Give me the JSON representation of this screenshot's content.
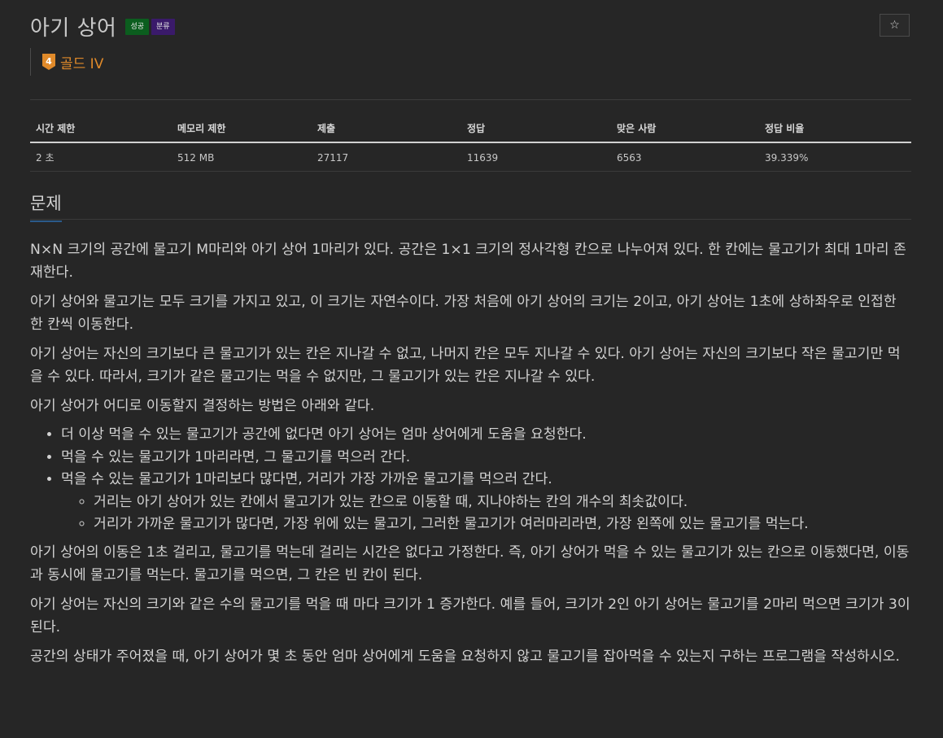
{
  "problem": {
    "title": "아기 상어",
    "badges": {
      "success": "성공",
      "tags": "분류"
    },
    "star_icon": "☆",
    "tier": {
      "number": "4",
      "label": "골드 IV",
      "color": "#e08a2a"
    }
  },
  "info_table": {
    "headers": [
      "시간 제한",
      "메모리 제한",
      "제출",
      "정답",
      "맞은 사람",
      "정답 비율"
    ],
    "values": [
      "2 초",
      "512 MB",
      "27117",
      "11639",
      "6563",
      "39.339%"
    ]
  },
  "section": {
    "title": "문제"
  },
  "description": {
    "p1": "N×N 크기의 공간에 물고기 M마리와 아기 상어 1마리가 있다. 공간은 1×1 크기의 정사각형 칸으로 나누어져 있다. 한 칸에는 물고기가 최대 1마리 존재한다.",
    "p2": "아기 상어와 물고기는 모두 크기를 가지고 있고, 이 크기는 자연수이다. 가장 처음에 아기 상어의 크기는 2이고, 아기 상어는 1초에 상하좌우로 인접한 한 칸씩 이동한다.",
    "p3": "아기 상어는 자신의 크기보다 큰 물고기가 있는 칸은 지나갈 수 없고, 나머지 칸은 모두 지나갈 수 있다. 아기 상어는 자신의 크기보다 작은 물고기만 먹을 수 있다. 따라서, 크기가 같은 물고기는 먹을 수 없지만, 그 물고기가 있는 칸은 지나갈 수 있다.",
    "p4": "아기 상어가 어디로 이동할지 결정하는 방법은 아래와 같다.",
    "list": [
      "더 이상 먹을 수 있는 물고기가 공간에 없다면 아기 상어는 엄마 상어에게 도움을 요청한다.",
      "먹을 수 있는 물고기가 1마리라면, 그 물고기를 먹으러 간다.",
      "먹을 수 있는 물고기가 1마리보다 많다면, 거리가 가장 가까운 물고기를 먹으러 간다."
    ],
    "sublist": [
      "거리는 아기 상어가 있는 칸에서 물고기가 있는 칸으로 이동할 때, 지나야하는 칸의 개수의 최솟값이다.",
      "거리가 가까운 물고기가 많다면, 가장 위에 있는 물고기, 그러한 물고기가 여러마리라면, 가장 왼쪽에 있는 물고기를 먹는다."
    ],
    "p5": "아기 상어의 이동은 1초 걸리고, 물고기를 먹는데 걸리는 시간은 없다고 가정한다. 즉, 아기 상어가 먹을 수 있는 물고기가 있는 칸으로 이동했다면, 이동과 동시에 물고기를 먹는다. 물고기를 먹으면, 그 칸은 빈 칸이 된다.",
    "p6": "아기 상어는 자신의 크기와 같은 수의 물고기를 먹을 때 마다 크기가 1 증가한다. 예를 들어, 크기가 2인 아기 상어는 물고기를 2마리 먹으면 크기가 3이 된다.",
    "p7": "공간의 상태가 주어졌을 때, 아기 상어가 몇 초 동안 엄마 상어에게 도움을 요청하지 않고 물고기를 잡아먹을 수 있는지 구하는 프로그램을 작성하시오."
  }
}
